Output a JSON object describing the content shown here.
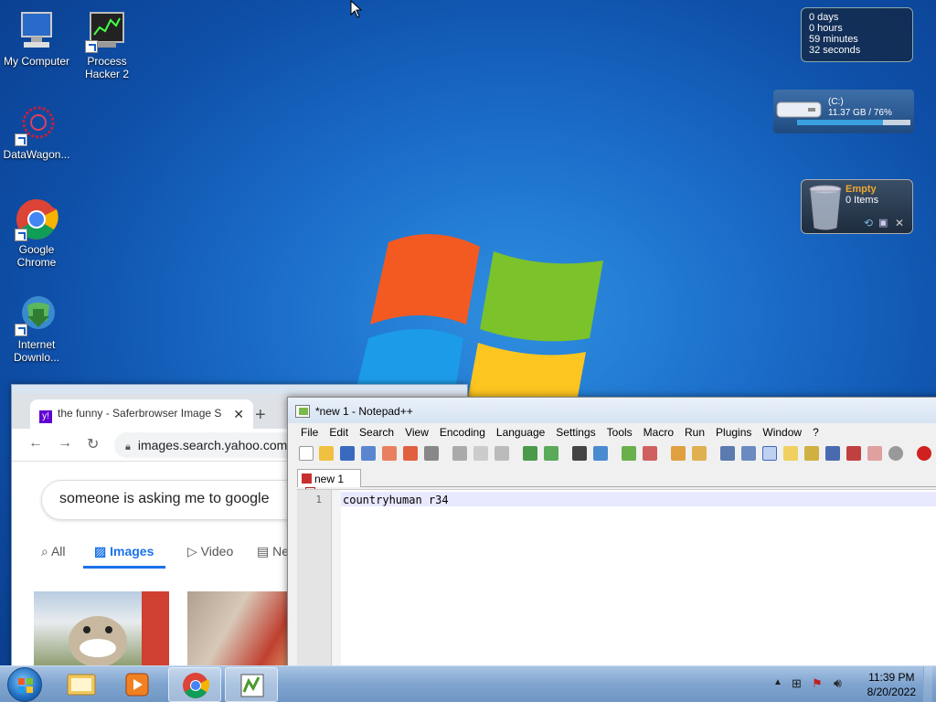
{
  "desktop": {
    "icons": [
      {
        "label": "My Computer"
      },
      {
        "label": "Process\nHacker 2"
      },
      {
        "label": "DataWagon..."
      },
      {
        "label": "Google\nChrome"
      },
      {
        "label": "Internet\nDownlo..."
      }
    ]
  },
  "gadgets": {
    "uptime": {
      "days": "0 days",
      "hours": "0 hours",
      "minutes": "59 minutes",
      "seconds": "32 seconds"
    },
    "drive": {
      "name": "(C:)",
      "usage": "11.37 GB / 76%",
      "fill_percent": 76
    },
    "recycle": {
      "status": "Empty",
      "items": "0 Items"
    }
  },
  "browser": {
    "tab_title": "the funny - Saferbrowser Image S",
    "url": "images.search.yahoo.com",
    "search_query": "someone is asking me to google",
    "filters": [
      "All",
      "Images",
      "Video",
      "New"
    ],
    "active_filter": "Images"
  },
  "notepadpp": {
    "title": "*new 1 - Notepad++",
    "menu": [
      "File",
      "Edit",
      "Search",
      "View",
      "Encoding",
      "Language",
      "Settings",
      "Tools",
      "Macro",
      "Run",
      "Plugins",
      "Window",
      "?"
    ],
    "tab": "new 1",
    "line_number": "1",
    "content": "countryhuman r34"
  },
  "taskbar": {
    "time": "11:39 PM",
    "date": "8/20/2022"
  },
  "colors": {
    "accent": "#1a73e8",
    "npp_tab_red": "#c83030"
  }
}
